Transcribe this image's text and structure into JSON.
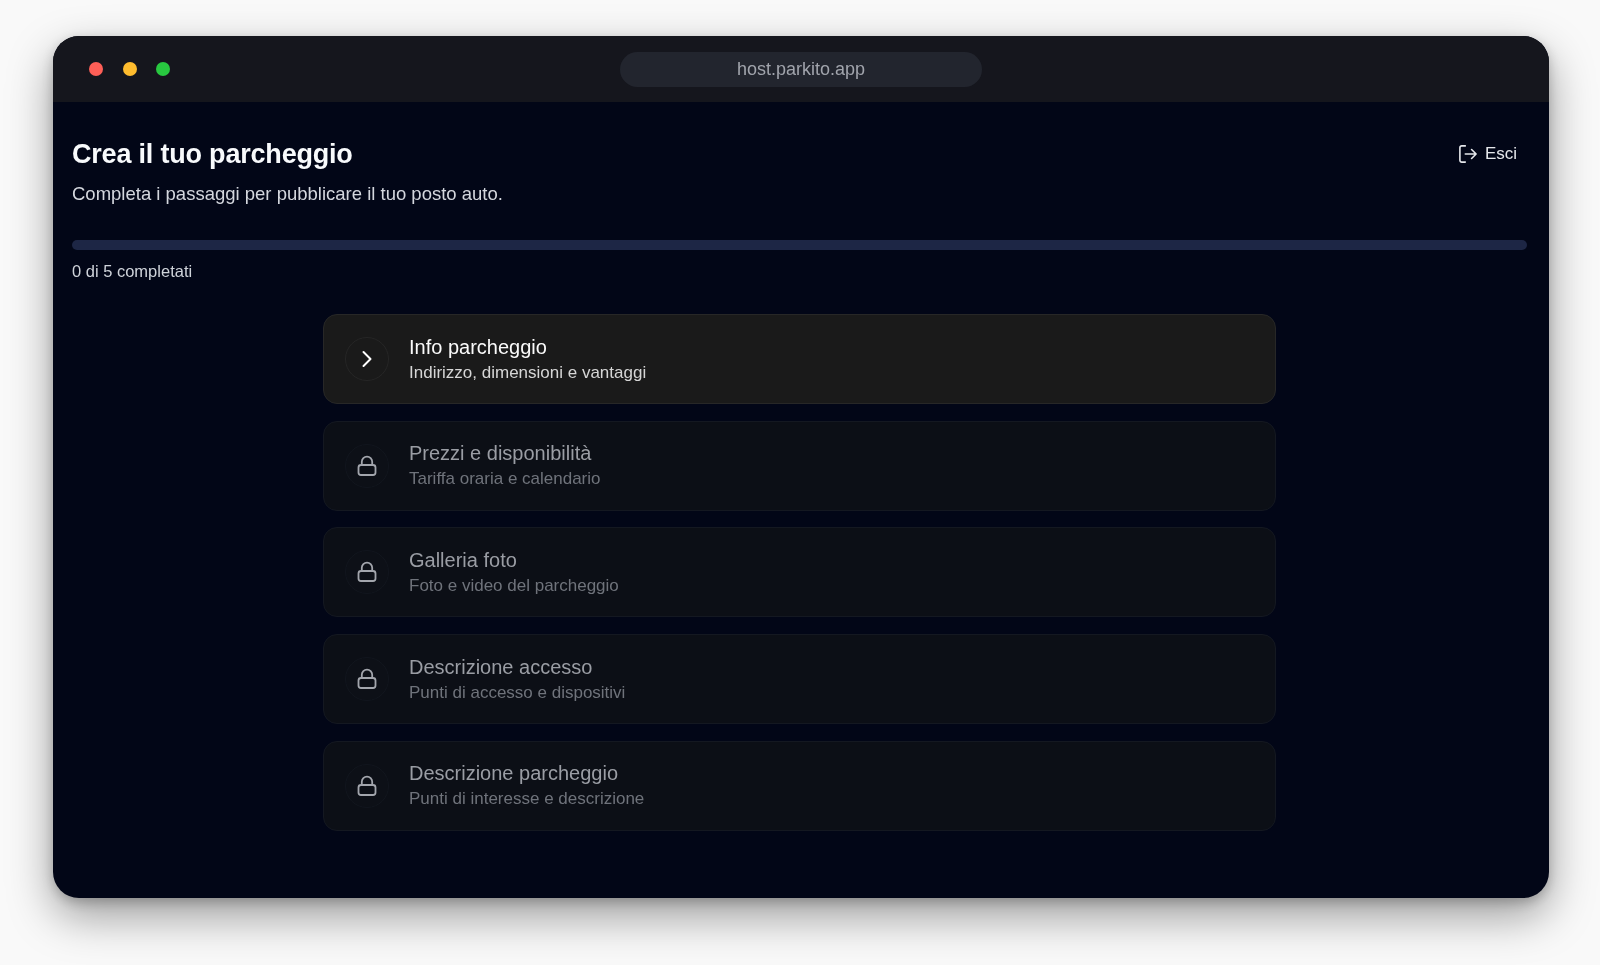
{
  "window": {
    "url": "host.parkito.app"
  },
  "header": {
    "title": "Crea il tuo parcheggio",
    "subtitle": "Completa i passaggi per pubblicare il tuo posto auto.",
    "exit_button": "Esci"
  },
  "progress": {
    "level": 0,
    "caption": "0 di 5 completati"
  },
  "steps": [
    {
      "title": "Info parcheggio",
      "subtitle": "Indirizzo, dimensioni e vantaggi",
      "locked": false
    },
    {
      "title": "Prezzi e disponibilità",
      "subtitle": "Tariffa oraria e calendario",
      "locked": true
    },
    {
      "title": "Galleria foto",
      "subtitle": "Foto e video del parcheggio",
      "locked": true
    },
    {
      "title": "Descrizione accesso",
      "subtitle": "Punti di accesso e dispositivi",
      "locked": true
    },
    {
      "title": "Descrizione parcheggio",
      "subtitle": "Punti di interesse e descrizione",
      "locked": true
    }
  ]
}
